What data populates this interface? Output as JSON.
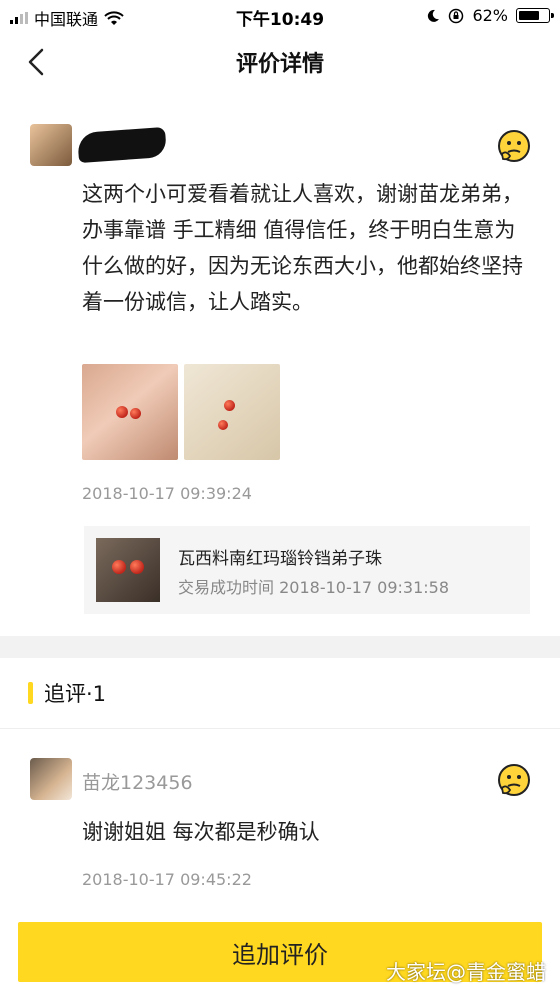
{
  "status_bar": {
    "carrier": "中国联通",
    "time": "下午10:49",
    "battery": "62%",
    "battery_level": 0.62
  },
  "nav": {
    "title": "评价详情"
  },
  "review": {
    "text": "这两个小可爱看着就让人喜欢，谢谢苗龙弟弟，办事靠谱 手工精细 值得信任，终于明白生意为什么做的好，因为无论东西大小，他都始终坚持着一份诚信，让人踏实。",
    "time": "2018-10-17 09:39:24",
    "product": {
      "name": "瓦西料南红玛瑙铃铛弟子珠",
      "trade_label": "交易成功时间",
      "trade_time": "2018-10-17 09:31:58"
    }
  },
  "followup_section": {
    "title": "追评·1"
  },
  "followup": {
    "user": "苗龙123456",
    "text": "谢谢姐姐 每次都是秒确认",
    "time": "2018-10-17 09:45:22"
  },
  "footer": {
    "button": "追加评价",
    "watermark": "大家坛@青金蜜蜡"
  },
  "colors": {
    "accent": "#ffd81f",
    "muted": "#999999"
  },
  "icons": [
    "signal-icon",
    "wifi-icon",
    "moon-icon",
    "lock-rotation-icon",
    "battery-icon",
    "back-arrow-icon",
    "thinking-emoji-icon"
  ]
}
